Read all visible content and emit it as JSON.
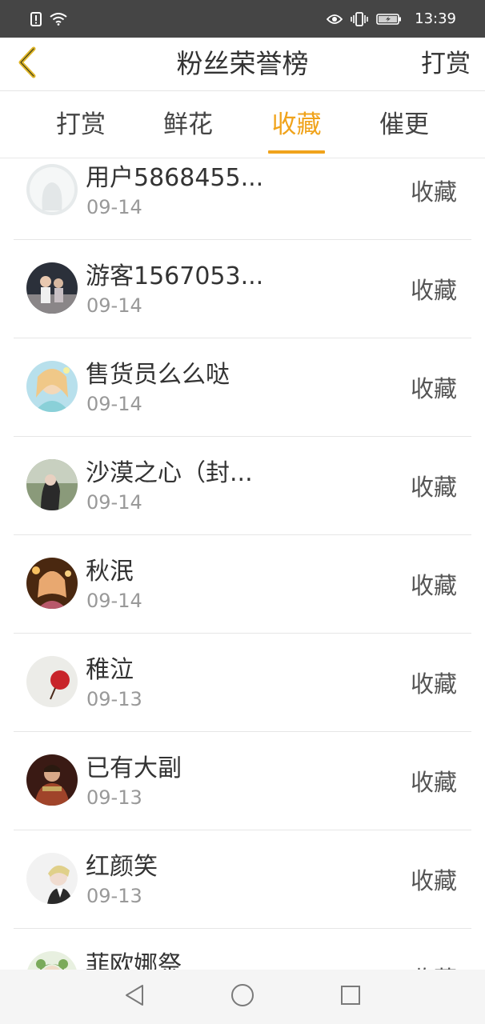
{
  "status_bar": {
    "time": "13:39"
  },
  "header": {
    "title": "粉丝荣誉榜",
    "action": "打赏"
  },
  "tabs": [
    {
      "label": "打赏",
      "active": false
    },
    {
      "label": "鲜花",
      "active": false
    },
    {
      "label": "收藏",
      "active": true
    },
    {
      "label": "催更",
      "active": false
    }
  ],
  "fans": [
    {
      "name": "用户5868455...",
      "date": "09-14",
      "action": "收藏",
      "avatar_colors": [
        "#dfe3e4",
        "#f4f6f6"
      ]
    },
    {
      "name": "游客1567053...",
      "date": "09-14",
      "action": "收藏",
      "avatar_colors": [
        "#2a2f3a",
        "#9a8c8a"
      ]
    },
    {
      "name": "售货员么么哒",
      "date": "09-14",
      "action": "收藏",
      "avatar_colors": [
        "#a8d8e8",
        "#f2d2a8"
      ]
    },
    {
      "name": "沙漠之心（封...",
      "date": "09-14",
      "action": "收藏",
      "avatar_colors": [
        "#5a6b4e",
        "#c8cfc0"
      ]
    },
    {
      "name": "秋泯",
      "date": "09-14",
      "action": "收藏",
      "avatar_colors": [
        "#5a3418",
        "#e7b27a"
      ]
    },
    {
      "name": "稚泣",
      "date": "09-13",
      "action": "收藏",
      "avatar_colors": [
        "#e8e8e6",
        "#c8242a"
      ]
    },
    {
      "name": "已有大副",
      "date": "09-13",
      "action": "收藏",
      "avatar_colors": [
        "#3a1a14",
        "#a84a2a"
      ]
    },
    {
      "name": "红颜笑",
      "date": "09-13",
      "action": "收藏",
      "avatar_colors": [
        "#f0f0f0",
        "#d8cfa4"
      ]
    },
    {
      "name": "菲欧娜祭",
      "date": "",
      "action": "收藏",
      "avatar_colors": [
        "#b8d8a8",
        "#5e8a4a"
      ]
    }
  ],
  "colors": {
    "accent": "#f0a31b",
    "status_bar_bg": "#454545"
  }
}
